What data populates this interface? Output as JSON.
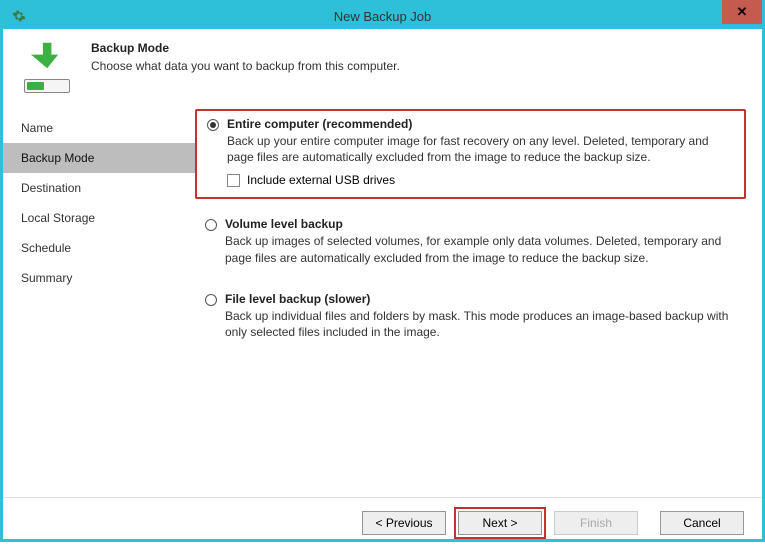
{
  "window": {
    "title": "New Backup Job",
    "close": "✕"
  },
  "header": {
    "title": "Backup Mode",
    "subtitle": "Choose what data you want to backup from this computer."
  },
  "sidebar": {
    "items": [
      {
        "label": "Name",
        "selected": false
      },
      {
        "label": "Backup Mode",
        "selected": true
      },
      {
        "label": "Destination",
        "selected": false
      },
      {
        "label": "Local Storage",
        "selected": false
      },
      {
        "label": "Schedule",
        "selected": false
      },
      {
        "label": "Summary",
        "selected": false
      }
    ]
  },
  "options": {
    "entire": {
      "title": "Entire computer (recommended)",
      "desc": "Back up your entire computer image for fast recovery on any level. Deleted, temporary and page files are automatically excluded from the image to reduce the backup size.",
      "include_usb_label": "Include external USB drives"
    },
    "volume": {
      "title": "Volume level backup",
      "desc": "Back up images of selected volumes, for example only data volumes. Deleted, temporary and page files are automatically excluded from the image to reduce the backup size."
    },
    "file": {
      "title": "File level backup (slower)",
      "desc": "Back up individual files and folders by mask. This mode produces an image-based backup with only selected files included in the image."
    }
  },
  "footer": {
    "previous": "< Previous",
    "next": "Next >",
    "finish": "Finish",
    "cancel": "Cancel"
  }
}
